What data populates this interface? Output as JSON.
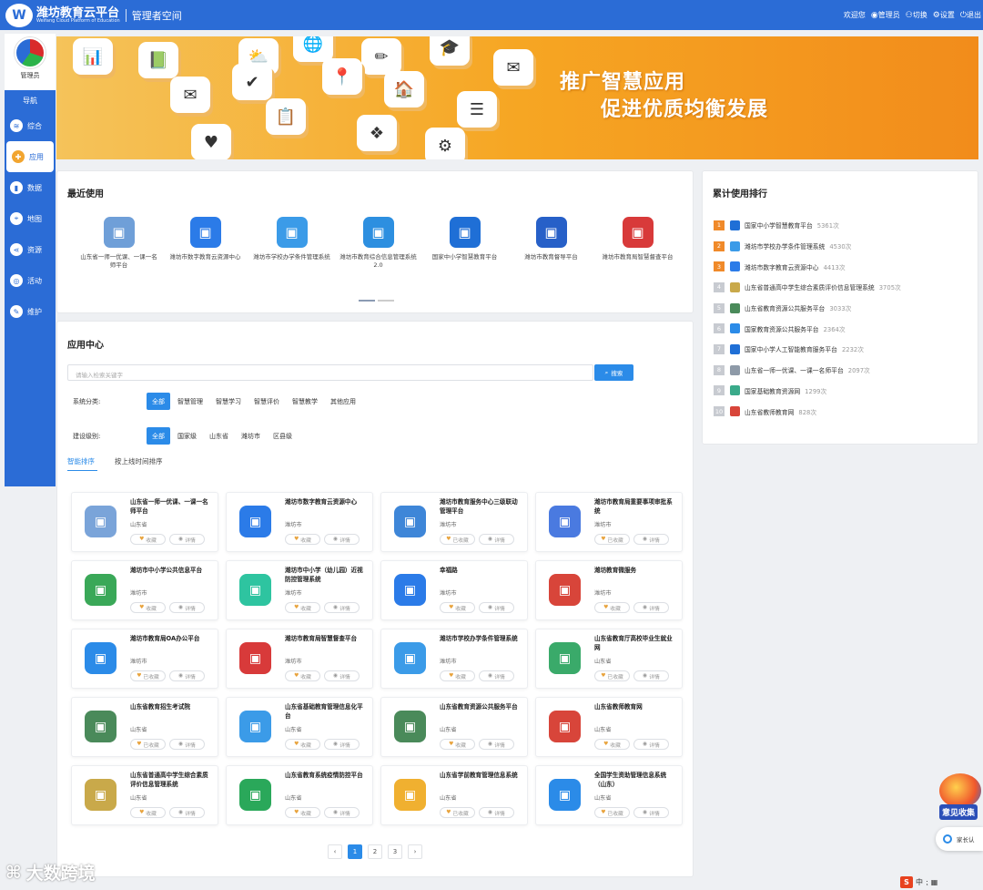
{
  "header": {
    "brand_cn": "潍坊教育云平台",
    "brand_en": "Weifang Cloud Platform of Education",
    "space": "管理者空间",
    "welcome": "欢迎您",
    "user": "管理员",
    "switch": "切换",
    "settings": "设置",
    "logout": "退出"
  },
  "sidebar": {
    "role": "管理员",
    "nav_label": "导航",
    "items": [
      {
        "label": "综合",
        "icon": "layers-icon"
      },
      {
        "label": "应用",
        "icon": "apps-icon"
      },
      {
        "label": "数据",
        "icon": "bar-chart-icon"
      },
      {
        "label": "地图",
        "icon": "map-pin-icon"
      },
      {
        "label": "资源",
        "icon": "share-icon"
      },
      {
        "label": "活动",
        "icon": "target-icon"
      },
      {
        "label": "维护",
        "icon": "wrench-icon"
      }
    ],
    "active_index": 1
  },
  "banner": {
    "line1": "推广智慧应用",
    "line2": "促进优质均衡发展"
  },
  "recent": {
    "title": "最近使用",
    "items": [
      {
        "name": "山东省一师一优课、一课一名师平台",
        "color": "#6f9fd8"
      },
      {
        "name": "潍坊市数字教育云资源中心",
        "color": "#2b7be8"
      },
      {
        "name": "潍坊市学校办学条件管理系统",
        "color": "#3b9be8"
      },
      {
        "name": "潍坊市教育综合信息管理系统 2.0",
        "color": "#2d8fe0"
      },
      {
        "name": "国家中小学智慧教育平台",
        "color": "#1f6fd6"
      },
      {
        "name": "潍坊市教育督导平台",
        "color": "#2760c8"
      },
      {
        "name": "潍坊市教育局智慧督查平台",
        "color": "#d83a3a"
      }
    ]
  },
  "rank": {
    "title": "累计使用排行",
    "items": [
      {
        "no": "1",
        "name": "国家中小学智慧教育平台",
        "count": "5361次",
        "color": "#1f6fd6"
      },
      {
        "no": "2",
        "name": "潍坊市学校办学条件管理系统",
        "count": "4530次",
        "color": "#3b9be8"
      },
      {
        "no": "3",
        "name": "潍坊市数字教育云资源中心",
        "count": "4413次",
        "color": "#2b7be8"
      },
      {
        "no": "4",
        "name": "山东省普通高中学生综合素质评价信息管理系统",
        "count": "3705次",
        "color": "#c9a94a"
      },
      {
        "no": "5",
        "name": "山东省教育资源公共服务平台",
        "count": "3033次",
        "color": "#4a8a5a"
      },
      {
        "no": "6",
        "name": "国家教育资源公共服务平台",
        "count": "2364次",
        "color": "#2b8be8"
      },
      {
        "no": "7",
        "name": "国家中小学人工智能教育服务平台",
        "count": "2232次",
        "color": "#1f6fd6"
      },
      {
        "no": "8",
        "name": "山东省一师一优课、一课一名师平台",
        "count": "2097次",
        "color": "#8e9aa8"
      },
      {
        "no": "9",
        "name": "国家基础教育资源网",
        "count": "1299次",
        "color": "#3aaa8a"
      },
      {
        "no": "10",
        "name": "山东省教师教育网",
        "count": "828次",
        "color": "#d8453a"
      }
    ]
  },
  "center": {
    "title": "应用中心",
    "search_placeholder": "请输入检索关键字",
    "search_btn": "搜索",
    "category_label": "系统分类:",
    "categories": [
      "全部",
      "智慧管理",
      "智慧学习",
      "智慧评价",
      "智慧教学",
      "其他应用"
    ],
    "level_label": "建设级别:",
    "levels": [
      "全部",
      "国家级",
      "山东省",
      "潍坊市",
      "区县级"
    ],
    "tabs": [
      "智能排序",
      "按上线时间排序"
    ],
    "fav": "收藏",
    "faved": "已收藏",
    "detail": "详情",
    "apps": [
      {
        "name": "山东省一师一优课、一课一名师平台",
        "region": "山东省",
        "faved": false,
        "color": "#7aa4d9"
      },
      {
        "name": "潍坊市数字教育云资源中心",
        "region": "潍坊市",
        "faved": false,
        "color": "#2b7be8"
      },
      {
        "name": "潍坊市教育服务中心三级联动管理平台",
        "region": "潍坊市",
        "faved": true,
        "color": "#3e86d8"
      },
      {
        "name": "潍坊市教育局重要事项审批系统",
        "region": "潍坊市",
        "faved": true,
        "color": "#4a7ae0"
      },
      {
        "name": "潍坊市中小学公共信息平台",
        "region": "潍坊市",
        "faved": false,
        "color": "#3aa858"
      },
      {
        "name": "潍坊市中小学（幼儿园）近视防控管理系统",
        "region": "潍坊市",
        "faved": false,
        "color": "#2ec4a0"
      },
      {
        "name": "幸福路",
        "region": "潍坊市",
        "faved": false,
        "color": "#2b7be8"
      },
      {
        "name": "潍坊教育微服务",
        "region": "潍坊市",
        "faved": false,
        "color": "#d8453a"
      },
      {
        "name": "潍坊市教育局OA办公平台",
        "region": "潍坊市",
        "faved": true,
        "color": "#2b8be8"
      },
      {
        "name": "潍坊市教育局智慧督查平台",
        "region": "潍坊市",
        "faved": false,
        "color": "#d83a3a"
      },
      {
        "name": "潍坊市学校办学条件管理系统",
        "region": "潍坊市",
        "faved": false,
        "color": "#3b9be8"
      },
      {
        "name": "山东省教育厅高校毕业生就业网",
        "region": "山东省",
        "faved": true,
        "color": "#3aaa6a"
      },
      {
        "name": "山东省教育招生考试院",
        "region": "山东省",
        "faved": true,
        "color": "#4a8a5a"
      },
      {
        "name": "山东省基础教育管理信息化平台",
        "region": "山东省",
        "faved": false,
        "color": "#3b9be8"
      },
      {
        "name": "山东省教育资源公共服务平台",
        "region": "山东省",
        "faved": false,
        "color": "#4a8a5a"
      },
      {
        "name": "山东省教师教育网",
        "region": "山东省",
        "faved": false,
        "color": "#d8453a"
      },
      {
        "name": "山东省普通高中学生综合素质评价信息管理系统",
        "region": "山东省",
        "faved": false,
        "color": "#c9a94a"
      },
      {
        "name": "山东省教育系统疫情防控平台",
        "region": "山东省",
        "faved": false,
        "color": "#2aa85a"
      },
      {
        "name": "山东省学前教育管理信息系统",
        "region": "山东省",
        "faved": true,
        "color": "#f0b030"
      },
      {
        "name": "全国学生资助管理信息系统（山东）",
        "region": "山东省",
        "faved": true,
        "color": "#2b8be8"
      }
    ],
    "pages": [
      "‹",
      "1",
      "2",
      "3",
      "›"
    ],
    "current_page": "1"
  },
  "floats": {
    "feedback": "意见收集",
    "parent": "家长认"
  },
  "watermark": "大数跨境"
}
